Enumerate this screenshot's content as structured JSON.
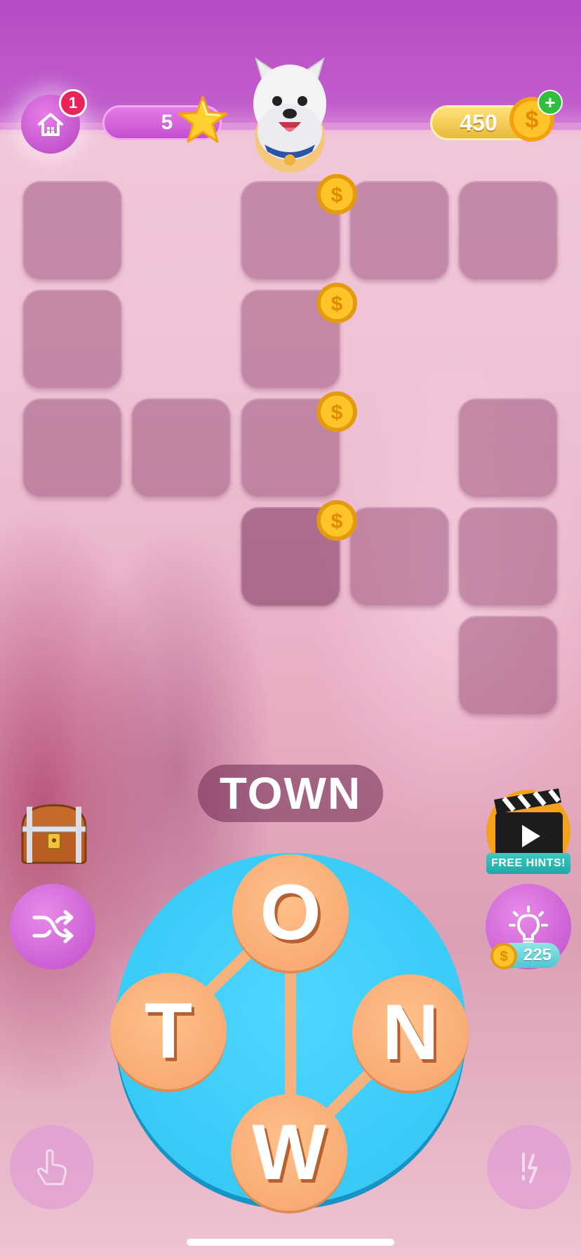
{
  "hud": {
    "notification_count": "1",
    "level": "5",
    "coins": "450",
    "add_coins_symbol": "+"
  },
  "board": {
    "current_word": "TOWN"
  },
  "wheel": {
    "letters": [
      "O",
      "T",
      "N",
      "W"
    ]
  },
  "buttons": {
    "free_hints_label": "FREE HINTS!",
    "hint_cost": "225"
  },
  "colors": {
    "top_bar": "#b64cc4",
    "wheel": "#2ec5f3",
    "letter_tile": "#f6a36c",
    "grid_cell": "#7a2858"
  }
}
